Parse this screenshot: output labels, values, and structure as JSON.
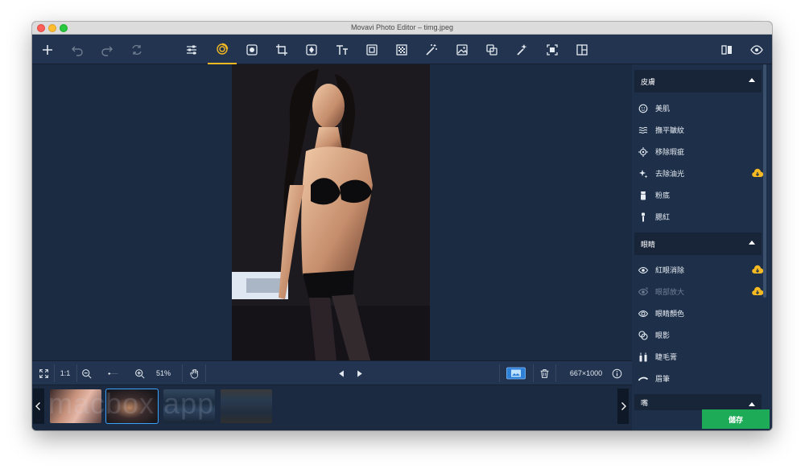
{
  "window": {
    "title": "Movavi Photo Editor – timg.jpeg"
  },
  "toolbar": {
    "left": [
      "plus-icon",
      "undo-icon",
      "redo-icon",
      "reset-icon"
    ],
    "tools": [
      "adjust-sliders-icon",
      "retouch-icon",
      "effects-icon",
      "crop-icon",
      "transform-icon",
      "text-icon",
      "frame-icon",
      "noise-icon",
      "magic-wand-icon",
      "background-icon",
      "object-removal-icon",
      "auto-enhance-icon",
      "selection-icon",
      "layout-icon"
    ],
    "right": [
      "compare-icon",
      "preview-eye-icon"
    ],
    "active_tool": "retouch-icon"
  },
  "bottom_bar": {
    "fit_icon": "fit-to-screen-icon",
    "actual_size_label": "1:1",
    "zoom_value": "51%",
    "zoom_level": 0.05,
    "hand_icon": "hand-icon",
    "image_size": "667×1000",
    "info_icon": "info-icon"
  },
  "sidebar": {
    "sections": [
      {
        "title": "皮膚",
        "items": [
          {
            "label": "美肌",
            "icon": "skin-smooth-icon",
            "cloud": false,
            "disabled": false
          },
          {
            "label": "撫平皺紋",
            "icon": "wrinkle-icon",
            "cloud": false,
            "disabled": false
          },
          {
            "label": "移除瑕疵",
            "icon": "blemish-icon",
            "cloud": false,
            "disabled": false
          },
          {
            "label": "去除油光",
            "icon": "shine-icon",
            "cloud": true,
            "disabled": false
          },
          {
            "label": "粉底",
            "icon": "foundation-icon",
            "cloud": false,
            "disabled": false
          },
          {
            "label": "腮紅",
            "icon": "blush-icon",
            "cloud": false,
            "disabled": false
          }
        ]
      },
      {
        "title": "眼睛",
        "items": [
          {
            "label": "紅眼消除",
            "icon": "red-eye-icon",
            "cloud": true,
            "disabled": false
          },
          {
            "label": "眼部放大",
            "icon": "eye-enlarge-icon",
            "cloud": true,
            "disabled": true
          },
          {
            "label": "眼睛顏色",
            "icon": "eye-color-icon",
            "cloud": false,
            "disabled": false
          },
          {
            "label": "眼影",
            "icon": "eyeshadow-icon",
            "cloud": false,
            "disabled": false
          },
          {
            "label": "睫毛膏",
            "icon": "mascara-icon",
            "cloud": false,
            "disabled": false
          },
          {
            "label": "眉筆",
            "icon": "eyebrow-icon",
            "cloud": false,
            "disabled": false
          }
        ]
      },
      {
        "title": "嘴",
        "items": []
      }
    ]
  },
  "save_button": {
    "label": "儲存"
  },
  "watermark": "macbox app",
  "colors": {
    "accent": "#f5b921",
    "save": "#1eab57",
    "panel": "#1e3049",
    "canvas": "#1a2b42"
  }
}
